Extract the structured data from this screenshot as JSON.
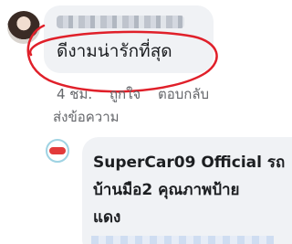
{
  "comment": {
    "author": "",
    "text": "ดีงามน่ารักที่สุด",
    "time": "4 ชม.",
    "like_label": "ถูกใจ",
    "reply_label": "ตอบกลับ",
    "send_message_label": "ส่งข้อความ"
  },
  "reply": {
    "line1": "SuperCar09 Official รถ",
    "line2": "บ้านมือ2 คุณภาพป้าย",
    "line3": "แดง"
  },
  "colors": {
    "bubble": "#f0f2f5",
    "annotation_circle": "#e0202a",
    "meta_text": "#65676b"
  }
}
